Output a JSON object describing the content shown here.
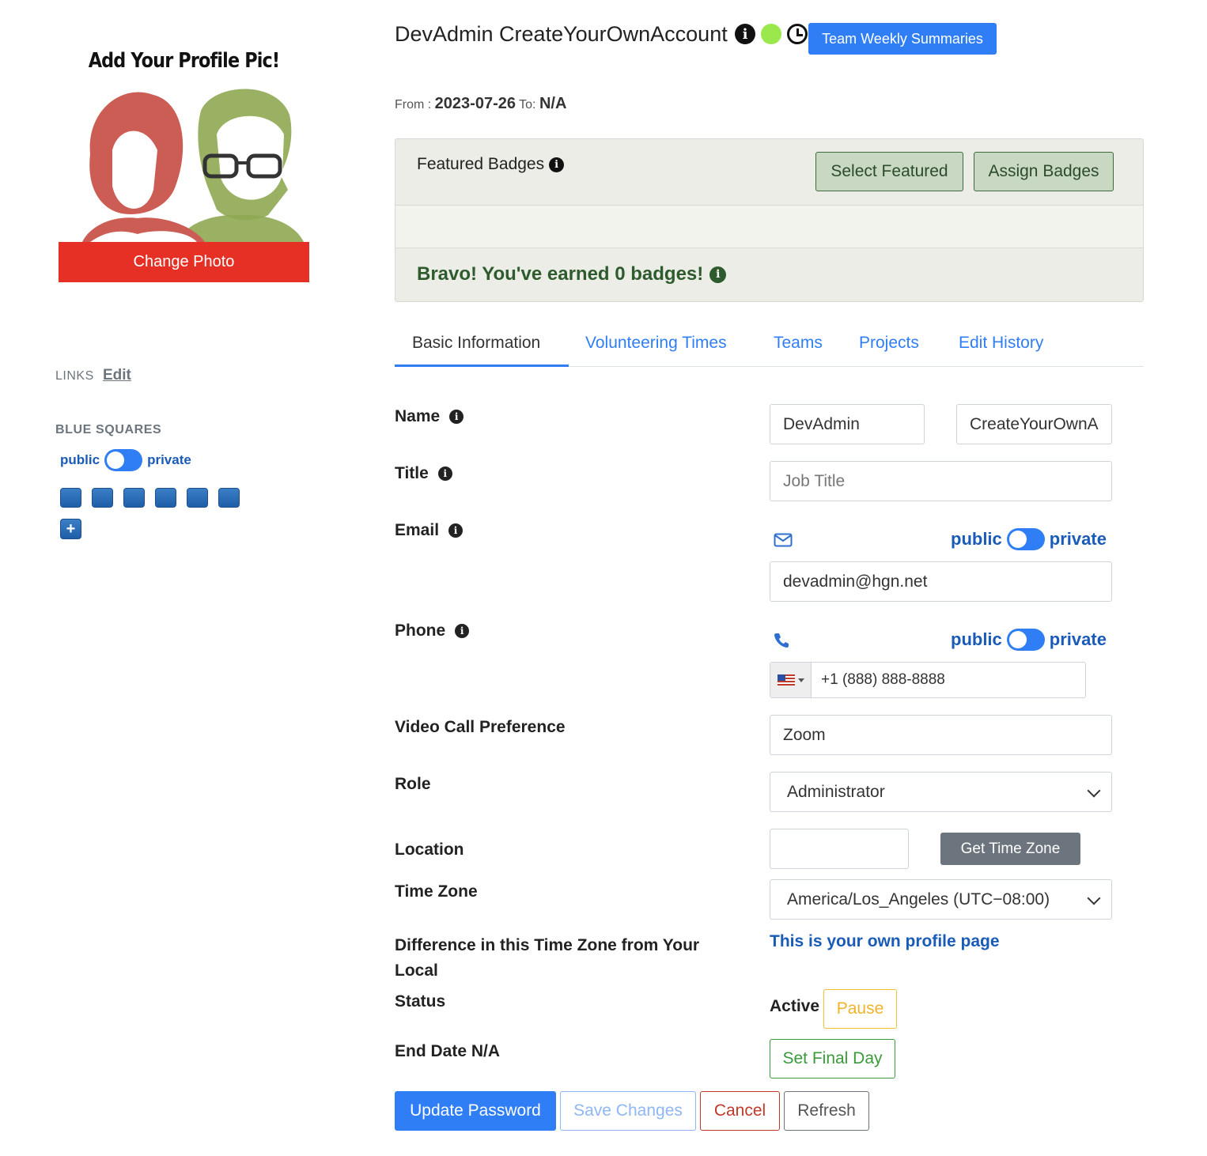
{
  "profile": {
    "pic_title": "Add Your Profile Pic!",
    "change_photo_label": "Change Photo"
  },
  "sidebar": {
    "links_label": "LINKS",
    "links_edit": "Edit",
    "blue_squares_label": "BLUE SQUARES",
    "toggle_public": "public",
    "toggle_private": "private",
    "blue_square_count": 6,
    "add_label": "+"
  },
  "header": {
    "user_name": "DevAdmin CreateYourOwnAccount",
    "info_glyph": "i",
    "team_weekly_label": "Team Weekly Summaries",
    "from_label": "From :",
    "from_date": "2023-07-26",
    "to_label": "To:",
    "to_value": "N/A"
  },
  "badges": {
    "title": "Featured Badges",
    "select_featured": "Select Featured",
    "assign_badges": "Assign Badges",
    "bravo_text": "Bravo! You've earned 0 badges!"
  },
  "tabs": [
    {
      "label": "Basic Information",
      "active": true
    },
    {
      "label": "Volunteering Times",
      "active": false
    },
    {
      "label": "Teams",
      "active": false
    },
    {
      "label": "Projects",
      "active": false
    },
    {
      "label": "Edit History",
      "active": false
    }
  ],
  "form": {
    "name_label": "Name",
    "first_name": "DevAdmin",
    "last_name": "CreateYourOwnA",
    "title_label": "Title",
    "title_placeholder": "Job Title",
    "email_label": "Email",
    "email_value": "devadmin@hgn.net",
    "phone_label": "Phone",
    "phone_value": "+1 (888) 888-8888",
    "public": "public",
    "private": "private",
    "video_label": "Video Call Preference",
    "video_value": "Zoom",
    "role_label": "Role",
    "role_value": "Administrator",
    "location_label": "Location",
    "location_value": "",
    "get_time_zone": "Get Time Zone",
    "tz_label": "Time Zone",
    "tz_value": "America/Los_Angeles (UTC−08:00)",
    "diff_label_1": "Difference in this Time Zone from Your",
    "diff_label_2": "Local",
    "diff_value": "This is your own profile page",
    "status_label": "Status",
    "status_value": "Active",
    "pause_label": "Pause",
    "end_date_label": "End Date N/A",
    "set_final_day": "Set Final Day"
  },
  "actions": {
    "update_password": "Update Password",
    "save_changes": "Save Changes",
    "cancel": "Cancel",
    "refresh": "Refresh"
  },
  "colors": {
    "primary": "#2f7ef5",
    "change_photo_red": "#e63025",
    "badge_green": "#2e5b2e",
    "status_dot": "#9be84c"
  }
}
